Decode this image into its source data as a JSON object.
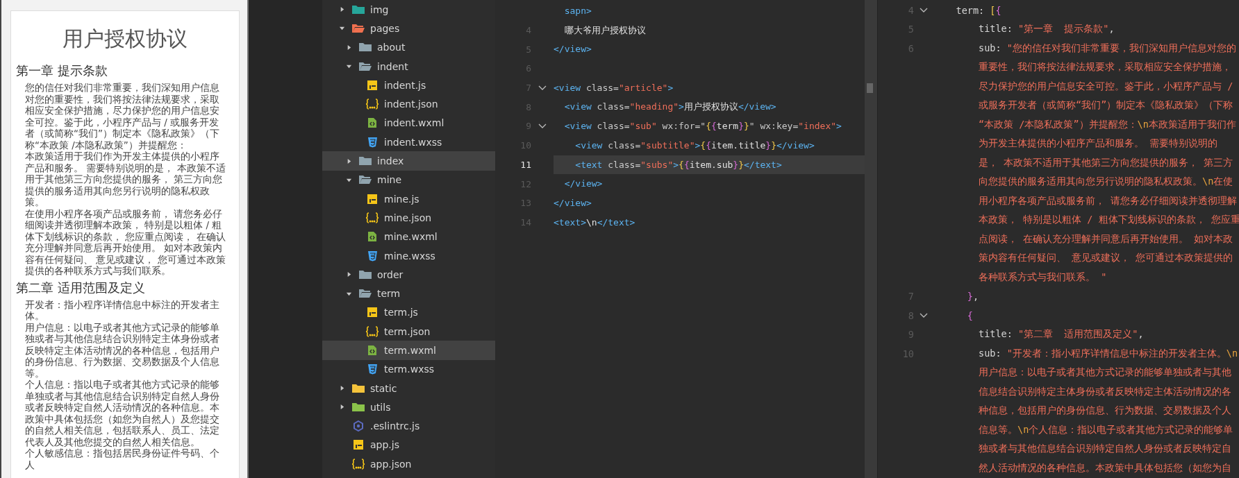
{
  "preview": {
    "title": "用户授权协议",
    "sections": [
      {
        "title": "第一章 提示条款",
        "paragraphs": [
          "您的信任对我们非常重要，我们深知用户信息对您的重要性，我们将按法律法规要求，采取相应安全保护措施，尽力保护您的用户信息安全可控。鉴于此，小程序产品与 / 或服务开发者（或简称“我们”）制定本《隐私政策》（下称“本政策 /本隐私政策”）并提醒您：",
          "本政策适用于我们作为开发主体提供的小程序产品和服务。 需要特别说明的是， 本政策不适用于其他第三方向您提供的服务， 第三方向您提供的服务适用其向您另行说明的隐私权政策。",
          "在使用小程序各项产品或服务前， 请您务必仔细阅读并透彻理解本政策， 特别是以粗体 / 粗体下划线标识的条款， 您应重点阅读， 在确认充分理解并同意后再开始使用。 如对本政策内容有任何疑问、 意见或建议， 您可通过本政策提供的各种联系方式与我们联系。"
        ]
      },
      {
        "title": "第二章 适用范围及定义",
        "paragraphs": [
          "开发者：指小程序详情信息中标注的开发者主体。",
          "用户信息：以电子或者其他方式记录的能够单独或者与其他信息结合识别特定主体身份或者反映特定主体活动情况的各种信息，包括用户的身份信息、行为数据、交易数据及个人信息等。",
          "个人信息：指以电子或者其他方式记录的能够单独或者与其他信息结合识别特定自然人身份或者反映特定自然人活动情况的各种信息。本政策中具体包括您（如您为自然人）及您提交的自然人相关信息，包括联系人、员工、法定代表人及其他您提交的自然人相关信息。",
          "个人敏感信息：指包括居民身份证件号码、个人"
        ]
      }
    ]
  },
  "file_tree": {
    "items": [
      {
        "name": "img",
        "kind": "folder",
        "color": "#26a69a",
        "expanded": false,
        "selected": false
      },
      {
        "name": "pages",
        "kind": "folder",
        "color": "#f0704f",
        "expanded": true,
        "selected": false,
        "children": [
          {
            "name": "about",
            "kind": "folder",
            "expanded": false,
            "selected": false
          },
          {
            "name": "indent",
            "kind": "folder",
            "expanded": true,
            "selected": false,
            "children": [
              {
                "name": "indent.js",
                "kind": "js",
                "selected": false
              },
              {
                "name": "indent.json",
                "kind": "json",
                "selected": false
              },
              {
                "name": "indent.wxml",
                "kind": "wxml",
                "selected": false
              },
              {
                "name": "indent.wxss",
                "kind": "wxss",
                "selected": false
              }
            ]
          },
          {
            "name": "index",
            "kind": "folder",
            "expanded": false,
            "selected": true
          },
          {
            "name": "mine",
            "kind": "folder",
            "expanded": true,
            "selected": false,
            "children": [
              {
                "name": "mine.js",
                "kind": "js",
                "selected": false
              },
              {
                "name": "mine.json",
                "kind": "json",
                "selected": false
              },
              {
                "name": "mine.wxml",
                "kind": "wxml",
                "selected": false
              },
              {
                "name": "mine.wxss",
                "kind": "wxss",
                "selected": false
              }
            ]
          },
          {
            "name": "order",
            "kind": "folder",
            "expanded": false,
            "selected": false
          },
          {
            "name": "term",
            "kind": "folder",
            "expanded": true,
            "selected": false,
            "children": [
              {
                "name": "term.js",
                "kind": "js",
                "selected": false
              },
              {
                "name": "term.json",
                "kind": "json",
                "selected": false
              },
              {
                "name": "term.wxml",
                "kind": "wxml",
                "selected": true
              },
              {
                "name": "term.wxss",
                "kind": "wxss",
                "selected": false
              }
            ]
          }
        ]
      },
      {
        "name": "static",
        "kind": "folder",
        "color": "#f5c33b",
        "expanded": false,
        "selected": false
      },
      {
        "name": "utils",
        "kind": "folder",
        "color": "#8bc34a",
        "expanded": false,
        "selected": false
      },
      {
        "name": ".eslintrc.js",
        "kind": "eslint",
        "selected": false
      },
      {
        "name": "app.js",
        "kind": "js",
        "selected": false
      },
      {
        "name": "app.json",
        "kind": "json",
        "selected": false
      }
    ]
  },
  "wxml_editor": {
    "lines": [
      {
        "fold": false,
        "current": false,
        "tokens": [
          {
            "kind": "tag",
            "text": "  sapn>"
          }
        ]
      },
      {
        "number": "4",
        "fold": false,
        "current": false,
        "tokens": [
          {
            "kind": "text",
            "text": "  哪大爷用户授权协议"
          }
        ]
      },
      {
        "number": "5",
        "fold": false,
        "current": false,
        "tokens": [
          {
            "kind": "tag",
            "text": "</view>"
          }
        ]
      },
      {
        "number": "6",
        "fold": false,
        "current": false
      },
      {
        "number": "7",
        "fold": true,
        "current": false,
        "tokens": [
          {
            "kind": "tag",
            "text": "<view"
          },
          {
            "kind": "attr",
            "text": " class="
          },
          {
            "kind": "string",
            "text": "\"article\""
          },
          {
            "kind": "tag",
            "text": ">"
          }
        ]
      },
      {
        "number": "8",
        "fold": false,
        "current": false,
        "tokens": [
          {
            "kind": "tag",
            "text": "  <view"
          },
          {
            "kind": "attr",
            "text": " class="
          },
          {
            "kind": "string",
            "text": "\"heading\""
          },
          {
            "kind": "tag",
            "text": ">"
          },
          {
            "kind": "text",
            "text": "用户授权协议"
          },
          {
            "kind": "tag",
            "text": "</view>"
          }
        ]
      },
      {
        "number": "9",
        "fold": true,
        "current": false,
        "tokens": [
          {
            "kind": "tag",
            "text": "  <view"
          },
          {
            "kind": "attr",
            "text": " class="
          },
          {
            "kind": "string",
            "text": "\"sub\""
          },
          {
            "kind": "attr",
            "text": " wx:for=\""
          },
          {
            "kind": "brace_a",
            "text": "{"
          },
          {
            "kind": "brace_b",
            "text": "{"
          },
          {
            "kind": "text",
            "text": "term"
          },
          {
            "kind": "brace_b",
            "text": "}"
          },
          {
            "kind": "brace_a",
            "text": "}"
          },
          {
            "kind": "attr",
            "text": "\" wx:key="
          },
          {
            "kind": "string",
            "text": "\"index\""
          },
          {
            "kind": "tag",
            "text": ">"
          }
        ]
      },
      {
        "number": "10",
        "fold": false,
        "current": false,
        "tokens": [
          {
            "kind": "tag",
            "text": "    <view"
          },
          {
            "kind": "attr",
            "text": " class="
          },
          {
            "kind": "string",
            "text": "\"subtitle\""
          },
          {
            "kind": "tag",
            "text": ">"
          },
          {
            "kind": "brace_a",
            "text": "{"
          },
          {
            "kind": "brace_b",
            "text": "{"
          },
          {
            "kind": "text",
            "text": "item.title"
          },
          {
            "kind": "brace_b",
            "text": "}"
          },
          {
            "kind": "brace_a",
            "text": "}"
          },
          {
            "kind": "tag",
            "text": "</view>"
          }
        ]
      },
      {
        "number": "11",
        "fold": false,
        "current": true,
        "tokens": [
          {
            "kind": "tag",
            "text": "    <text"
          },
          {
            "kind": "attr",
            "text": " class="
          },
          {
            "kind": "string",
            "text": "\"subs\""
          },
          {
            "kind": "tag",
            "text": ">"
          },
          {
            "kind": "brace_a",
            "text": "{"
          },
          {
            "kind": "brace_b",
            "text": "{"
          },
          {
            "kind": "text",
            "text": "item.sub"
          },
          {
            "kind": "brace_b",
            "text": "}"
          },
          {
            "kind": "brace_a",
            "text": "}"
          },
          {
            "kind": "tag",
            "text": "</text>"
          }
        ]
      },
      {
        "number": "12",
        "fold": false,
        "current": false,
        "tokens": [
          {
            "kind": "tag",
            "text": "  </view>"
          }
        ]
      },
      {
        "number": "13",
        "fold": false,
        "current": false,
        "tokens": [
          {
            "kind": "tag",
            "text": "</view>"
          }
        ]
      },
      {
        "number": "14",
        "fold": false,
        "current": false,
        "tokens": [
          {
            "kind": "tag",
            "text": "<text>"
          },
          {
            "kind": "text",
            "text": "\\n"
          },
          {
            "kind": "tag",
            "text": "</text>"
          }
        ]
      }
    ]
  },
  "js_editor": {
    "lines": [
      {
        "number": "4",
        "fold": true,
        "tokens": [
          {
            "kind": "key",
            "text": "    term: "
          },
          {
            "kind": "brace_a",
            "text": "["
          },
          {
            "kind": "brace_b",
            "text": "{"
          }
        ]
      },
      {
        "number": "5",
        "fold": false,
        "tokens": [
          {
            "kind": "key",
            "text": "        title: "
          },
          {
            "kind": "string",
            "text": "\"第一章  提示条款\""
          },
          {
            "kind": "punct",
            "text": ","
          }
        ]
      },
      {
        "number": "6",
        "fold": false,
        "tokens": [
          {
            "kind": "key",
            "text": "        sub: "
          },
          {
            "kind": "string",
            "text": "\"您的信任对我们非常重要，我们深知用户信息对您的"
          }
        ]
      },
      {
        "fold": false,
        "tokens": [
          {
            "kind": "string",
            "text": "        重要性，我们将按法律法规要求，采取相应安全保护措施，"
          }
        ]
      },
      {
        "fold": false,
        "tokens": [
          {
            "kind": "string",
            "text": "        尽力保护您的用户信息安全可控。鉴于此，小程序产品与 /"
          }
        ]
      },
      {
        "fold": false,
        "tokens": [
          {
            "kind": "string",
            "text": "        或服务开发者（或简称“我们”）制定本《隐私政策》（下称"
          }
        ]
      },
      {
        "fold": false,
        "tokens": [
          {
            "kind": "string",
            "text": "        “本政策 /本隐私政策”）并提醒您："
          },
          {
            "kind": "escape",
            "text": "\\n"
          },
          {
            "kind": "string",
            "text": "本政策适用于我们作"
          }
        ]
      },
      {
        "fold": false,
        "tokens": [
          {
            "kind": "string",
            "text": "        为开发主体提供的小程序产品和服务。 需要特别说明的"
          }
        ]
      },
      {
        "fold": false,
        "tokens": [
          {
            "kind": "string",
            "text": "        是， 本政策不适用于其他第三方向您提供的服务， 第三方"
          }
        ]
      },
      {
        "fold": false,
        "tokens": [
          {
            "kind": "string",
            "text": "        向您提供的服务适用其向您另行说明的隐私权政策。"
          },
          {
            "kind": "escape",
            "text": "\\n"
          },
          {
            "kind": "string",
            "text": "在使"
          }
        ]
      },
      {
        "fold": false,
        "tokens": [
          {
            "kind": "string",
            "text": "        用小程序各项产品或服务前， 请您务必仔细阅读并透彻理解"
          }
        ]
      },
      {
        "fold": false,
        "tokens": [
          {
            "kind": "string",
            "text": "        本政策， 特别是以粗体 / 粗体下划线标识的条款， 您应重"
          }
        ]
      },
      {
        "fold": false,
        "tokens": [
          {
            "kind": "string",
            "text": "        点阅读， 在确认充分理解并同意后再开始使用。 如对本政"
          }
        ]
      },
      {
        "fold": false,
        "tokens": [
          {
            "kind": "string",
            "text": "        策内容有任何疑问、 意见或建议， 您可通过本政策提供的"
          }
        ]
      },
      {
        "fold": false,
        "tokens": [
          {
            "kind": "string",
            "text": "        各种联系方式与我们联系。 \""
          }
        ]
      },
      {
        "number": "7",
        "fold": false,
        "tokens": [
          {
            "kind": "brace_b",
            "text": "      }"
          },
          {
            "kind": "punct",
            "text": ","
          }
        ]
      },
      {
        "number": "8",
        "fold": true,
        "tokens": [
          {
            "kind": "brace_b",
            "text": "      {"
          }
        ]
      },
      {
        "number": "9",
        "fold": false,
        "tokens": [
          {
            "kind": "key",
            "text": "        title: "
          },
          {
            "kind": "string",
            "text": "\"第二章  适用范围及定义\""
          },
          {
            "kind": "punct",
            "text": ","
          }
        ]
      },
      {
        "number": "10",
        "fold": false,
        "tokens": [
          {
            "kind": "key",
            "text": "        sub: "
          },
          {
            "kind": "string",
            "text": "\"开发者：指小程序详情信息中标注的开发者主体。"
          },
          {
            "kind": "escape",
            "text": "\\n"
          }
        ]
      },
      {
        "fold": false,
        "tokens": [
          {
            "kind": "string",
            "text": "        用户信息：以电子或者其他方式记录的能够单独或者与其他"
          }
        ]
      },
      {
        "fold": false,
        "tokens": [
          {
            "kind": "string",
            "text": "        信息结合识别特定主体身份或者反映特定主体活动情况的各"
          }
        ]
      },
      {
        "fold": false,
        "tokens": [
          {
            "kind": "string",
            "text": "        种信息，包括用户的身份信息、行为数据、交易数据及个人"
          }
        ]
      },
      {
        "fold": false,
        "tokens": [
          {
            "kind": "string",
            "text": "        信息等。"
          },
          {
            "kind": "escape",
            "text": "\\n"
          },
          {
            "kind": "string",
            "text": "个人信息：指以电子或者其他方式记录的能够单"
          }
        ]
      },
      {
        "fold": false,
        "tokens": [
          {
            "kind": "string",
            "text": "        独或者与其他信息结合识别特定自然人身份或者反映特定自"
          }
        ]
      },
      {
        "fold": false,
        "tokens": [
          {
            "kind": "string",
            "text": "        然人活动情况的各种信息。本政策中具体包括您（如您为自"
          }
        ]
      }
    ]
  }
}
